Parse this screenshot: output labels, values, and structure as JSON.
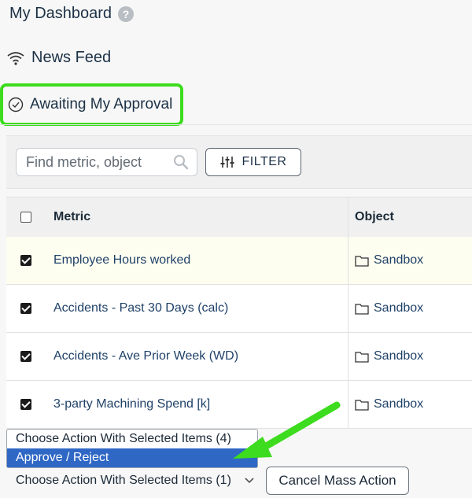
{
  "header": {
    "title": "My Dashboard",
    "help_icon": "?"
  },
  "nav": {
    "news_feed": "News Feed",
    "awaiting": "Awaiting My Approval"
  },
  "toolbar": {
    "search_placeholder": "Find metric, object",
    "filter_label": "FILTER"
  },
  "table": {
    "headers": {
      "metric": "Metric",
      "object": "Object"
    },
    "rows": [
      {
        "metric": "Employee Hours worked",
        "object": "Sandbox",
        "checked": true
      },
      {
        "metric": "Accidents - Past 30 Days (calc)",
        "object": "Sandbox",
        "checked": true
      },
      {
        "metric": "Accidents - Ave Prior Week (WD)",
        "object": "Sandbox",
        "checked": true
      },
      {
        "metric": "3-party Machining Spend [k]",
        "object": "Sandbox",
        "checked": true
      }
    ]
  },
  "mass_action": {
    "options": [
      "Choose Action With Selected Items (4)",
      "Approve / Reject"
    ],
    "selected_value": "Choose Action With Selected Items (1)",
    "cancel_label": "Cancel Mass Action"
  },
  "colors": {
    "highlight_border": "#3ddc1e",
    "arrow": "#3ddc1e",
    "menu_selected": "#2f67c5",
    "link_text": "#1f4168"
  }
}
